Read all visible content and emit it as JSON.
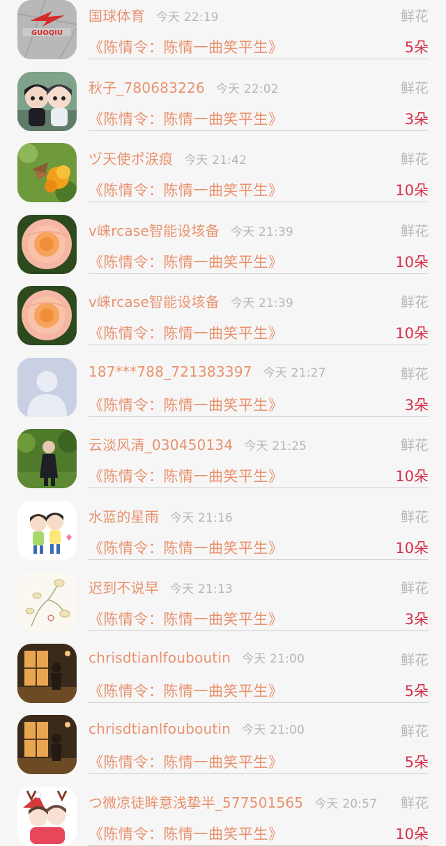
{
  "gift_list": {
    "items": [
      {
        "name": "国球体育",
        "time": "今天 22:19",
        "type": "鲜花",
        "work": "《陈情令：陈情一曲笑平生》",
        "count": "5朵",
        "avatar": "guoqiu-logo"
      },
      {
        "name": "秋子_780683226",
        "time": "今天 22:02",
        "type": "鲜花",
        "work": "《陈情令：陈情一曲笑平生》",
        "count": "3朵",
        "avatar": "figurines"
      },
      {
        "name": "ヅ天使ポ涙痕",
        "time": "今天 21:42",
        "type": "鲜花",
        "work": "《陈情令：陈情一曲笑平生》",
        "count": "10朵",
        "avatar": "butterfly-flower"
      },
      {
        "name": "v崃rcase智能设垓备",
        "time": "今天 21:39",
        "type": "鲜花",
        "work": "《陈情令：陈情一曲笑平生》",
        "count": "10朵",
        "avatar": "rose"
      },
      {
        "name": "v崃rcase智能设垓备",
        "time": "今天 21:39",
        "type": "鲜花",
        "work": "《陈情令：陈情一曲笑平生》",
        "count": "10朵",
        "avatar": "rose"
      },
      {
        "name": "187***788_721383397",
        "time": "今天 21:27",
        "type": "鲜花",
        "work": "《陈情令：陈情一曲笑平生》",
        "count": "3朵",
        "avatar": "default-user"
      },
      {
        "name": "云淡风清_030450134",
        "time": "今天 21:25",
        "type": "鲜花",
        "work": "《陈情令：陈情一曲笑平生》",
        "count": "10朵",
        "avatar": "person-garden"
      },
      {
        "name": "水蓝的星雨",
        "time": "今天 21:16",
        "type": "鲜花",
        "work": "《陈情令：陈情一曲笑平生》",
        "count": "10朵",
        "avatar": "cartoon-couple"
      },
      {
        "name": "迟到不说早",
        "time": "今天 21:13",
        "type": "鲜花",
        "work": "《陈情令：陈情一曲笑平生》",
        "count": "3朵",
        "avatar": "flower-sketch"
      },
      {
        "name": "chrisdtianlfouboutin",
        "time": "今天 21:00",
        "type": "鲜花",
        "work": "《陈情令：陈情一曲笑平生》",
        "count": "5朵",
        "avatar": "window-silhouette"
      },
      {
        "name": "chrisdtianlfouboutin",
        "time": "今天 21:00",
        "type": "鲜花",
        "work": "《陈情令：陈情一曲笑平生》",
        "count": "5朵",
        "avatar": "window-silhouette"
      },
      {
        "name": "つ微凉徒眸意浅挚半_577501565",
        "time": "今天 20:57",
        "type": "鲜花",
        "work": "《陈情令：陈情一曲笑平生》",
        "count": "10朵",
        "avatar": "christmas-anime"
      }
    ]
  },
  "colors": {
    "name_text": "#e8926d",
    "time_text": "#b6b6b6",
    "count_text": "#d3314a",
    "divider": "#cfcfcf",
    "background": "#f7f6f7"
  }
}
